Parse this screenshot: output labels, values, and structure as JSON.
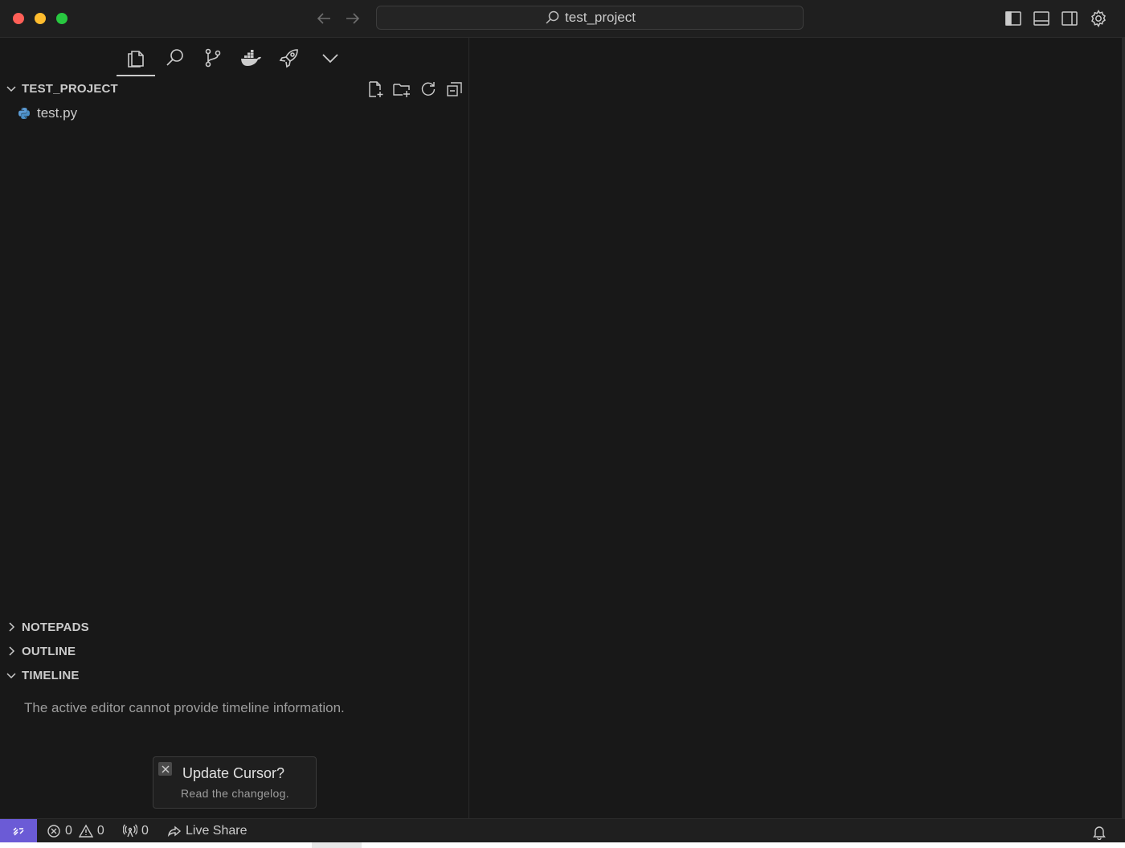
{
  "titlebar": {
    "search_text": "test_project"
  },
  "sidebar": {
    "tabs": [
      {
        "name": "explorer",
        "icon": "files-icon",
        "active": true
      },
      {
        "name": "search",
        "icon": "search-icon"
      },
      {
        "name": "source-control",
        "icon": "source-control-icon"
      },
      {
        "name": "docker",
        "icon": "docker-icon"
      },
      {
        "name": "deploy",
        "icon": "rocket-icon"
      },
      {
        "name": "more",
        "icon": "chevron-down-icon"
      }
    ],
    "explorer": {
      "title": "TEST_PROJECT",
      "actions": [
        "new-file-icon",
        "new-folder-icon",
        "refresh-icon",
        "collapse-all-icon"
      ],
      "files": [
        {
          "name": "test.py",
          "icon": "python-icon"
        }
      ]
    },
    "sections": {
      "notepads": "NOTEPADS",
      "outline": "OUTLINE",
      "timeline": "TIMELINE"
    },
    "timeline_message": "The active editor cannot provide timeline information."
  },
  "toast": {
    "title": "Update Cursor?",
    "subtitle": "Read the changelog."
  },
  "statusbar": {
    "errors": "0",
    "warnings": "0",
    "ports": "0",
    "live_share": "Live Share"
  },
  "colors": {
    "background": "#181818",
    "remote_button": "#6b5bd6",
    "traffic_red": "#ff5f57",
    "traffic_yellow": "#febc2e",
    "traffic_green": "#28c840"
  }
}
